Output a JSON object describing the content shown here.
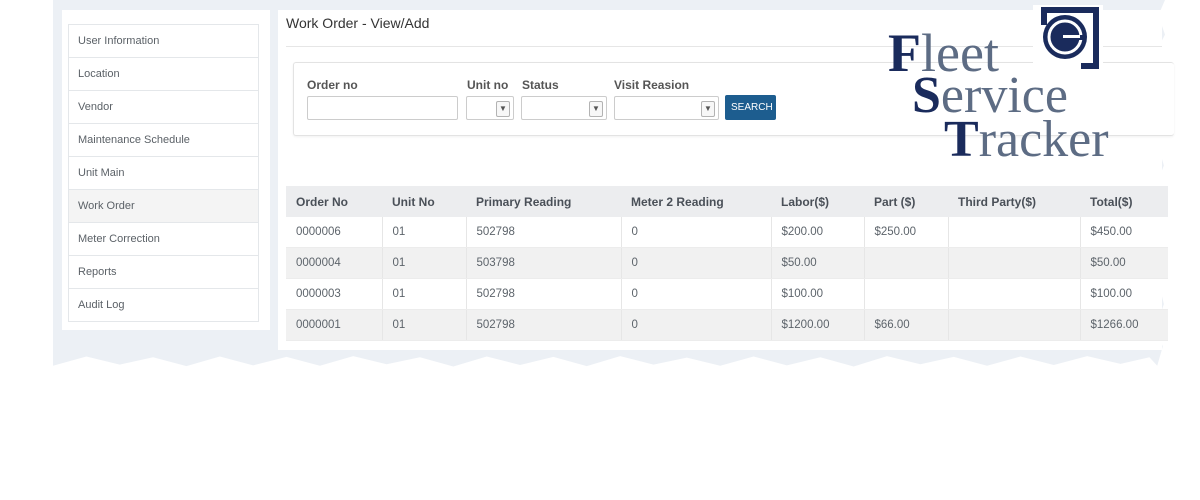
{
  "sidebar": {
    "items": [
      {
        "label": "User Information"
      },
      {
        "label": "Location"
      },
      {
        "label": "Vendor"
      },
      {
        "label": "Maintenance Schedule"
      },
      {
        "label": "Unit Main"
      },
      {
        "label": "Work Order",
        "active": true
      },
      {
        "label": "Meter Correction"
      },
      {
        "label": "Reports"
      },
      {
        "label": "Audit Log"
      }
    ]
  },
  "page": {
    "title": "Work Order - View/Add"
  },
  "filters": {
    "order_no_label": "Order no",
    "order_no_value": "",
    "unit_no_label": "Unit no",
    "unit_no_value": "",
    "status_label": "Status",
    "status_value": "",
    "visit_reason_label": "Visit Reasion",
    "visit_reason_value": "",
    "search_label": "SEARCH"
  },
  "table": {
    "headers": [
      "Order No",
      "Unit No",
      "Primary Reading",
      "Meter 2 Reading",
      "Labor($)",
      "Part ($)",
      "Third Party($)",
      "Total($)"
    ],
    "rows": [
      [
        "0000006",
        "01",
        "502798",
        "0",
        "$200.00",
        "$250.00",
        "",
        "$450.00"
      ],
      [
        "0000004",
        "01",
        "503798",
        "0",
        "$50.00",
        "",
        "",
        "$50.00"
      ],
      [
        "0000003",
        "01",
        "502798",
        "0",
        "$100.00",
        "",
        "",
        "$100.00"
      ],
      [
        "0000001",
        "01",
        "502798",
        "0",
        "$1200.00",
        "$66.00",
        "",
        "$1266.00"
      ]
    ]
  },
  "logo": {
    "line1_cap": "F",
    "line1_rest": "leet",
    "line2_cap": "S",
    "line2_rest": "ervice",
    "line3_cap": "T",
    "line3_rest": "racker",
    "emblem_letter": "G",
    "colors": {
      "navy": "#1a2b5c",
      "slate": "#5d6c84"
    }
  },
  "colors": {
    "accent": "#1d5d8f",
    "background": "#ecf0f5"
  }
}
